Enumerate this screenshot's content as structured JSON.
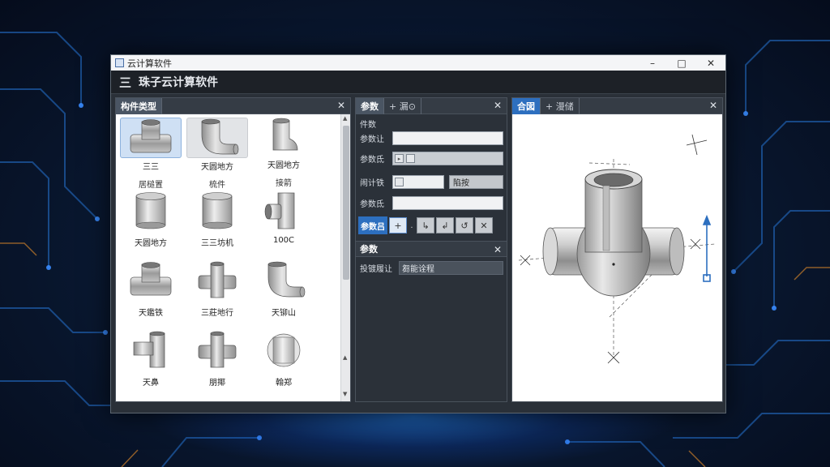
{
  "window": {
    "title": "云计算软件",
    "minimize": "–",
    "maximize": "□",
    "close": "✕"
  },
  "app": {
    "menu_icon": "三",
    "title": "珠子云计算软件"
  },
  "left_panel": {
    "tab": "构件类型",
    "close": "✕",
    "items": [
      {
        "name": "三三",
        "sub": "居槌置",
        "shape": "tee",
        "state": "selected"
      },
      {
        "name": "天圆地方",
        "sub": "梳件",
        "shape": "elbow",
        "state": "hover"
      },
      {
        "name": "天圆地方",
        "sub": "接箭",
        "shape": "reducer",
        "state": "normal"
      },
      {
        "name": "天圆地方",
        "sub": "",
        "shape": "cylinder",
        "state": "normal"
      },
      {
        "name": "三三坊机",
        "sub": "",
        "shape": "cylinder",
        "state": "normal"
      },
      {
        "name": "100C",
        "sub": "",
        "shape": "tee-side",
        "state": "normal"
      },
      {
        "name": "天鑑铁",
        "sub": "",
        "shape": "tee",
        "state": "normal"
      },
      {
        "name": "三莊地行",
        "sub": "",
        "shape": "cross",
        "state": "normal"
      },
      {
        "name": "天铆山",
        "sub": "",
        "shape": "elbow",
        "state": "normal"
      },
      {
        "name": "天鼻",
        "sub": "",
        "shape": "l-pipe",
        "state": "normal"
      },
      {
        "name": "朋揶",
        "sub": "",
        "shape": "cross",
        "state": "normal"
      },
      {
        "name": "翰郑",
        "sub": "",
        "shape": "flange",
        "state": "normal"
      }
    ]
  },
  "mid_panel": {
    "tab_active": "参数",
    "tab_other": "+ 漏⊙",
    "close": "✕",
    "section": "件数",
    "rows": [
      {
        "label": "参数让"
      },
      {
        "label": "参数氐"
      },
      {
        "label": "闹计铁",
        "button": "陷按"
      },
      {
        "label": "参数氐"
      }
    ],
    "toolbar_label": "参数吕",
    "tools": [
      "+",
      "↳",
      "↲",
      "↺",
      "✕"
    ],
    "sub_header": "参数",
    "sub_close": "✕",
    "sub_row_label": "投镀履让",
    "sub_row_value": "芻能诠程"
  },
  "right_panel": {
    "tab_active": "合図",
    "tab_other": "+ 漫储",
    "close": "✕"
  },
  "colors": {
    "accent": "#2d6fbf",
    "dark_bg": "#2b3139",
    "selected": "#cfe0f4"
  }
}
